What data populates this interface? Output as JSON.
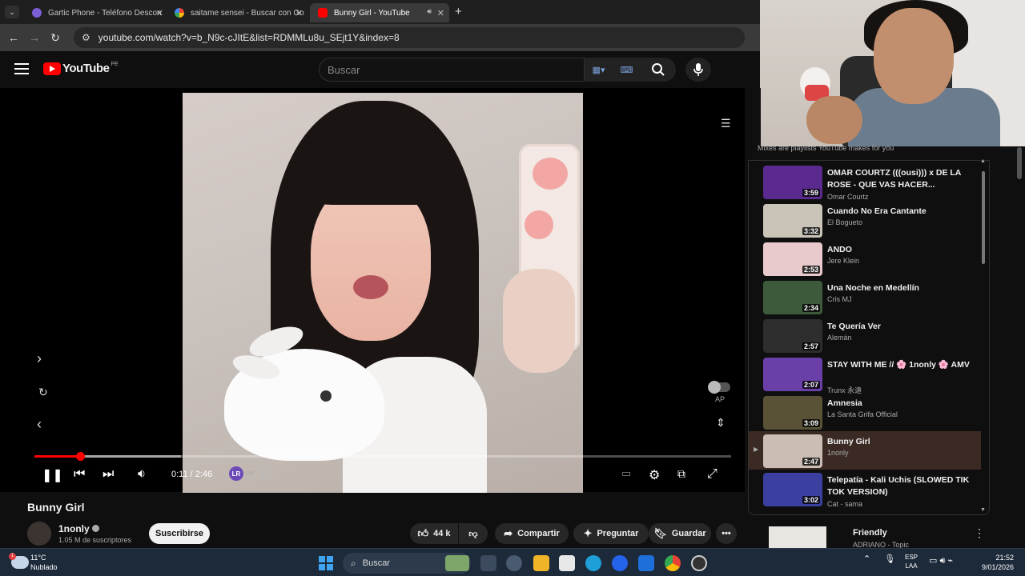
{
  "browser": {
    "tabs": [
      {
        "label": "Gartic Phone - Teléfono Descon",
        "icon": "gartic-icon"
      },
      {
        "label": "saitame sensei - Buscar con Go",
        "icon": "google-icon"
      },
      {
        "label": "Bunny Girl - YouTube",
        "icon": "youtube-icon",
        "active": true
      }
    ],
    "url": "youtube.com/watch?v=b_N9c-cJItE&list=RDMMLu8u_SEjt1Y&index=8"
  },
  "youtube": {
    "logo_text": "YouTube",
    "country_code": "PE",
    "search_placeholder": "Buscar"
  },
  "player": {
    "time": "0:11 / 2:46",
    "progress_fraction": 0.066,
    "buffered_fraction": 0.21,
    "lr_state": "ON",
    "autoplay_label": "AP"
  },
  "video": {
    "title": "Bunny Girl",
    "channel": "1nonly",
    "subscribers": "1.05 M de suscriptores",
    "subscribe_label": "Suscribirse",
    "likes": "44 k",
    "share_label": "Compartir",
    "ask_label": "Preguntar",
    "save_label": "Guardar"
  },
  "playlist": {
    "note": "Mixes are playlists YouTube makes for you",
    "items": [
      {
        "title": "OMAR COURTZ (((ousi))) x DE LA ROSE - QUE VAS HACER...",
        "channel": "Omar Courtz",
        "duration": "3:59",
        "thumb": "#5b2a8f"
      },
      {
        "title": "Cuando No Era Cantante",
        "channel": "El Bogueto",
        "duration": "3:32",
        "thumb": "#c9c3b8"
      },
      {
        "title": "ANDO",
        "channel": "Jere Klein",
        "duration": "2:53",
        "thumb": "#e8c9cc"
      },
      {
        "title": "Una Noche en Medellín",
        "channel": "Cris MJ",
        "duration": "2:34",
        "thumb": "#3d5a3a"
      },
      {
        "title": "Te Quería Ver",
        "channel": "Alemán",
        "duration": "2:57",
        "thumb": "#2e2e2e"
      },
      {
        "title": "STAY WITH ME // 🌸 1nonly 🌸 AMV",
        "channel": "Trunx 永遠",
        "duration": "2:07",
        "thumb": "#6a3fa8"
      },
      {
        "title": "Amnesia",
        "channel": "La Santa Grifa Official",
        "duration": "3:09",
        "thumb": "#5a5236"
      },
      {
        "title": "Bunny Girl",
        "channel": "1nonly",
        "duration": "2:47",
        "thumb": "#cbbcb4",
        "current": true
      },
      {
        "title": "Telepatía - Kali Uchis (SLOWED TIK TOK VERSION)",
        "channel": "Cat - sama",
        "duration": "3:02",
        "thumb": "#3a3fa0"
      }
    ]
  },
  "next": {
    "title": "Friendly",
    "channel": "ADRIANO - Topic"
  },
  "taskbar": {
    "temp": "11°C",
    "weather": "Nublado",
    "weather_badge": "1",
    "search": "Buscar",
    "lang1": "ESP",
    "lang2": "LAA",
    "time": "21:52",
    "date": "9/01/2026"
  }
}
